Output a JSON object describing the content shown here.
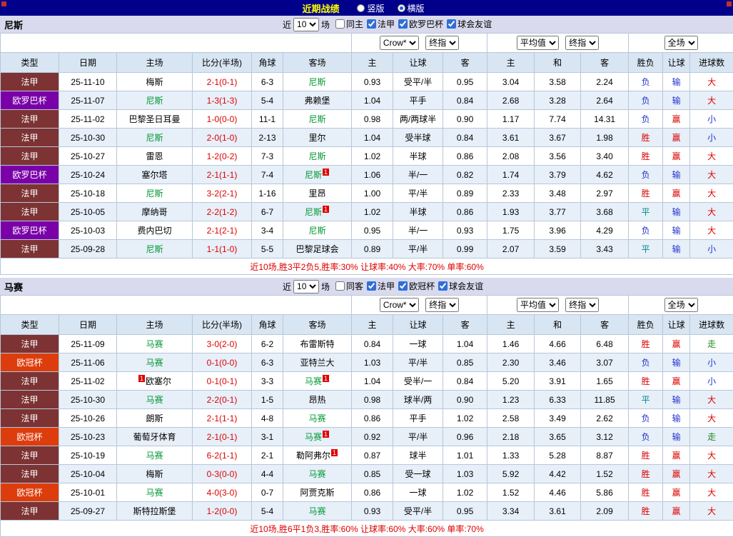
{
  "topbar": {
    "title": "近期战绩",
    "radios": [
      {
        "label": "竖版",
        "checked": false
      },
      {
        "label": "横版",
        "checked": true
      }
    ]
  },
  "palette": {
    "score": "#dd0000",
    "focus_team": "#009933",
    "footer": "#dd0000",
    "topbar_bg": "#00008b",
    "title_color": "#ffff00"
  },
  "type_colors": {
    "法甲": "#7d3333",
    "欧罗巴杯": "#7a00a8",
    "欧冠杯": "#dd3d0d"
  },
  "result_colors": {
    "胜": "#dd0000",
    "负": "#2233cc",
    "平": "#008888",
    "赢": "#dd0000",
    "输": "#2233cc",
    "大": "#dd0000",
    "小": "#2233cc",
    "走": "#1f8b1f"
  },
  "sections": [
    {
      "team": "尼斯",
      "filter": {
        "prefix": "近",
        "count": "10",
        "suffix": "场",
        "checkboxes": [
          {
            "label": "同主",
            "checked": false
          },
          {
            "label": "法甲",
            "checked": true
          },
          {
            "label": "欧罗巴杯",
            "checked": true
          },
          {
            "label": "球会友谊",
            "checked": true
          }
        ]
      },
      "selects": {
        "bookmaker": "Crow*",
        "bookmaker_mode": "终指",
        "avg": "平均值",
        "avg_mode": "终指",
        "scope": "全场"
      },
      "columns": [
        "类型",
        "日期",
        "主场",
        "比分(半场)",
        "角球",
        "客场",
        "主",
        "让球",
        "客",
        "主",
        "和",
        "客",
        "胜负",
        "让球",
        "进球数"
      ],
      "rows": [
        {
          "type": "法甲",
          "date": "25-11-10",
          "home": {
            "name": "梅斯"
          },
          "score": "2-1(0-1)",
          "corner": "6-3",
          "away": {
            "name": "尼斯",
            "focus": true
          },
          "o1": "0.93",
          "line": "受平/半",
          "o2": "0.95",
          "a1": "3.04",
          "a2": "3.58",
          "a3": "2.24",
          "res": "负",
          "hres": "输",
          "goal": "大"
        },
        {
          "type": "欧罗巴杯",
          "date": "25-11-07",
          "home": {
            "name": "尼斯",
            "focus": true
          },
          "score": "1-3(1-3)",
          "corner": "5-4",
          "away": {
            "name": "弗赖堡"
          },
          "o1": "1.04",
          "line": "平手",
          "o2": "0.84",
          "a1": "2.68",
          "a2": "3.28",
          "a3": "2.64",
          "res": "负",
          "hres": "输",
          "goal": "大"
        },
        {
          "type": "法甲",
          "date": "25-11-02",
          "home": {
            "name": "巴黎圣日耳曼"
          },
          "score": "1-0(0-0)",
          "corner": "11-1",
          "away": {
            "name": "尼斯",
            "focus": true
          },
          "o1": "0.98",
          "line": "两/两球半",
          "o2": "0.90",
          "a1": "1.17",
          "a2": "7.74",
          "a3": "14.31",
          "res": "负",
          "hres": "赢",
          "goal": "小"
        },
        {
          "type": "法甲",
          "date": "25-10-30",
          "home": {
            "name": "尼斯",
            "focus": true
          },
          "score": "2-0(1-0)",
          "corner": "2-13",
          "away": {
            "name": "里尔"
          },
          "o1": "1.04",
          "line": "受半球",
          "o2": "0.84",
          "a1": "3.61",
          "a2": "3.67",
          "a3": "1.98",
          "res": "胜",
          "hres": "赢",
          "goal": "小"
        },
        {
          "type": "法甲",
          "date": "25-10-27",
          "home": {
            "name": "雷恩"
          },
          "score": "1-2(0-2)",
          "corner": "7-3",
          "away": {
            "name": "尼斯",
            "focus": true
          },
          "o1": "1.02",
          "line": "半球",
          "o2": "0.86",
          "a1": "2.08",
          "a2": "3.56",
          "a3": "3.40",
          "res": "胜",
          "hres": "赢",
          "goal": "大"
        },
        {
          "type": "欧罗巴杯",
          "date": "25-10-24",
          "home": {
            "name": "塞尔塔"
          },
          "score": "2-1(1-1)",
          "corner": "7-4",
          "away": {
            "name": "尼斯",
            "focus": true,
            "badge": "after"
          },
          "o1": "1.06",
          "line": "半/一",
          "o2": "0.82",
          "a1": "1.74",
          "a2": "3.79",
          "a3": "4.62",
          "res": "负",
          "hres": "输",
          "goal": "大"
        },
        {
          "type": "法甲",
          "date": "25-10-18",
          "home": {
            "name": "尼斯",
            "focus": true
          },
          "score": "3-2(2-1)",
          "corner": "1-16",
          "away": {
            "name": "里昂"
          },
          "o1": "1.00",
          "line": "平/半",
          "o2": "0.89",
          "a1": "2.33",
          "a2": "3.48",
          "a3": "2.97",
          "res": "胜",
          "hres": "赢",
          "goal": "大"
        },
        {
          "type": "法甲",
          "date": "25-10-05",
          "home": {
            "name": "摩纳哥"
          },
          "score": "2-2(1-2)",
          "corner": "6-7",
          "away": {
            "name": "尼斯",
            "focus": true,
            "badge": "after"
          },
          "o1": "1.02",
          "line": "半球",
          "o2": "0.86",
          "a1": "1.93",
          "a2": "3.77",
          "a3": "3.68",
          "res": "平",
          "hres": "输",
          "goal": "大"
        },
        {
          "type": "欧罗巴杯",
          "date": "25-10-03",
          "home": {
            "name": "费内巴切"
          },
          "score": "2-1(2-1)",
          "corner": "3-4",
          "away": {
            "name": "尼斯",
            "focus": true
          },
          "o1": "0.95",
          "line": "半/一",
          "o2": "0.93",
          "a1": "1.75",
          "a2": "3.96",
          "a3": "4.29",
          "res": "负",
          "hres": "输",
          "goal": "大"
        },
        {
          "type": "法甲",
          "date": "25-09-28",
          "home": {
            "name": "尼斯",
            "focus": true
          },
          "score": "1-1(1-0)",
          "corner": "5-5",
          "away": {
            "name": "巴黎足球会"
          },
          "o1": "0.89",
          "line": "平/半",
          "o2": "0.99",
          "a1": "2.07",
          "a2": "3.59",
          "a3": "3.43",
          "res": "平",
          "hres": "输",
          "goal": "小"
        }
      ],
      "footer": "近10场,胜3平2负5,胜率:30% 让球率:40% 大率:70% 单率:60%"
    },
    {
      "team": "马赛",
      "filter": {
        "prefix": "近",
        "count": "10",
        "suffix": "场",
        "checkboxes": [
          {
            "label": "同客",
            "checked": false
          },
          {
            "label": "法甲",
            "checked": true
          },
          {
            "label": "欧冠杯",
            "checked": true
          },
          {
            "label": "球会友谊",
            "checked": true
          }
        ]
      },
      "selects": {
        "bookmaker": "Crow*",
        "bookmaker_mode": "终指",
        "avg": "平均值",
        "avg_mode": "终指",
        "scope": "全场"
      },
      "columns": [
        "类型",
        "日期",
        "主场",
        "比分(半场)",
        "角球",
        "客场",
        "主",
        "让球",
        "客",
        "主",
        "和",
        "客",
        "胜负",
        "让球",
        "进球数"
      ],
      "rows": [
        {
          "type": "法甲",
          "date": "25-11-09",
          "home": {
            "name": "马赛",
            "focus": true
          },
          "score": "3-0(2-0)",
          "corner": "6-2",
          "away": {
            "name": "布雷斯特"
          },
          "o1": "0.84",
          "line": "一球",
          "o2": "1.04",
          "a1": "1.46",
          "a2": "4.66",
          "a3": "6.48",
          "res": "胜",
          "hres": "赢",
          "goal": "走"
        },
        {
          "type": "欧冠杯",
          "date": "25-11-06",
          "home": {
            "name": "马赛",
            "focus": true
          },
          "score": "0-1(0-0)",
          "corner": "6-3",
          "away": {
            "name": "亚特兰大"
          },
          "o1": "1.03",
          "line": "平/半",
          "o2": "0.85",
          "a1": "2.30",
          "a2": "3.46",
          "a3": "3.07",
          "res": "负",
          "hres": "输",
          "goal": "小"
        },
        {
          "type": "法甲",
          "date": "25-11-02",
          "home": {
            "name": "欧塞尔",
            "badge": "before"
          },
          "score": "0-1(0-1)",
          "corner": "3-3",
          "away": {
            "name": "马赛",
            "focus": true,
            "badge": "after"
          },
          "o1": "1.04",
          "line": "受半/一",
          "o2": "0.84",
          "a1": "5.20",
          "a2": "3.91",
          "a3": "1.65",
          "res": "胜",
          "hres": "赢",
          "goal": "小"
        },
        {
          "type": "法甲",
          "date": "25-10-30",
          "home": {
            "name": "马赛",
            "focus": true
          },
          "score": "2-2(0-1)",
          "corner": "1-5",
          "away": {
            "name": "昂热"
          },
          "o1": "0.98",
          "line": "球半/两",
          "o2": "0.90",
          "a1": "1.23",
          "a2": "6.33",
          "a3": "11.85",
          "res": "平",
          "hres": "输",
          "goal": "大"
        },
        {
          "type": "法甲",
          "date": "25-10-26",
          "home": {
            "name": "朗斯"
          },
          "score": "2-1(1-1)",
          "corner": "4-8",
          "away": {
            "name": "马赛",
            "focus": true
          },
          "o1": "0.86",
          "line": "平手",
          "o2": "1.02",
          "a1": "2.58",
          "a2": "3.49",
          "a3": "2.62",
          "res": "负",
          "hres": "输",
          "goal": "大"
        },
        {
          "type": "欧冠杯",
          "date": "25-10-23",
          "home": {
            "name": "葡萄牙体育"
          },
          "score": "2-1(0-1)",
          "corner": "3-1",
          "away": {
            "name": "马赛",
            "focus": true,
            "badge": "after"
          },
          "o1": "0.92",
          "line": "平/半",
          "o2": "0.96",
          "a1": "2.18",
          "a2": "3.65",
          "a3": "3.12",
          "res": "负",
          "hres": "输",
          "goal": "走"
        },
        {
          "type": "法甲",
          "date": "25-10-19",
          "home": {
            "name": "马赛",
            "focus": true
          },
          "score": "6-2(1-1)",
          "corner": "2-1",
          "away": {
            "name": "勒阿弗尔",
            "badge": "after"
          },
          "o1": "0.87",
          "line": "球半",
          "o2": "1.01",
          "a1": "1.33",
          "a2": "5.28",
          "a3": "8.87",
          "res": "胜",
          "hres": "赢",
          "goal": "大"
        },
        {
          "type": "法甲",
          "date": "25-10-04",
          "home": {
            "name": "梅斯"
          },
          "score": "0-3(0-0)",
          "corner": "4-4",
          "away": {
            "name": "马赛",
            "focus": true
          },
          "o1": "0.85",
          "line": "受一球",
          "o2": "1.03",
          "a1": "5.92",
          "a2": "4.42",
          "a3": "1.52",
          "res": "胜",
          "hres": "赢",
          "goal": "大"
        },
        {
          "type": "欧冠杯",
          "date": "25-10-01",
          "home": {
            "name": "马赛",
            "focus": true
          },
          "score": "4-0(3-0)",
          "corner": "0-7",
          "away": {
            "name": "阿贾克斯"
          },
          "o1": "0.86",
          "line": "一球",
          "o2": "1.02",
          "a1": "1.52",
          "a2": "4.46",
          "a3": "5.86",
          "res": "胜",
          "hres": "赢",
          "goal": "大"
        },
        {
          "type": "法甲",
          "date": "25-09-27",
          "home": {
            "name": "斯特拉斯堡"
          },
          "score": "1-2(0-0)",
          "corner": "5-4",
          "away": {
            "name": "马赛",
            "focus": true
          },
          "o1": "0.93",
          "line": "受平/半",
          "o2": "0.95",
          "a1": "3.34",
          "a2": "3.61",
          "a3": "2.09",
          "res": "胜",
          "hres": "赢",
          "goal": "大"
        }
      ],
      "footer": "近10场,胜6平1负3,胜率:60% 让球率:60% 大率:60% 单率:70%"
    }
  ]
}
